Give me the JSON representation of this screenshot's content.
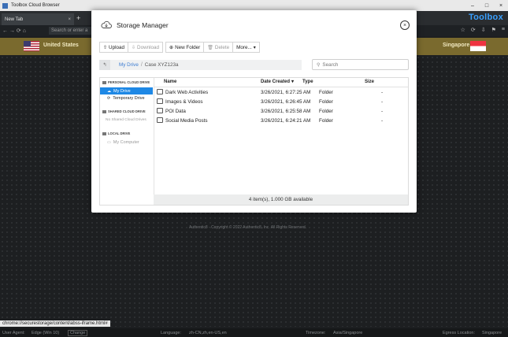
{
  "browser": {
    "window_title": "Toolbox Cloud Browser",
    "tab_title": "New Tab",
    "tab_close": "×",
    "new_tab": "+",
    "address_placeholder": "Search or enter a",
    "brand": "Toolbox",
    "window_controls": [
      "–",
      "□",
      "×"
    ],
    "nav": "← → ⟳ ⌂",
    "tools": [
      "☆",
      "⟳",
      "⇩",
      "⚑",
      "≡"
    ]
  },
  "banner": {
    "from_country": "United States",
    "to_country": "Singapore"
  },
  "page": {
    "footnote": "Authentic8 · Copyright © 2022 Authentic8, Inc. All Rights Reserved."
  },
  "status_url": "chrome://securestorage/content/abss-iframe.html#",
  "bottom_bar": {
    "user_agent_label": "User Agent:",
    "user_agent_value": "Edge (Win 10)",
    "user_agent_change": "Change",
    "language_label": "Language:",
    "language_value": "zh-CN,zh,en-US,en",
    "timezone_label": "Timezone:",
    "timezone_value": "Asia/Singapore",
    "egress_label": "Egress Location:",
    "egress_value": "Singapore"
  },
  "modal": {
    "title": "Storage Manager",
    "toolbar": {
      "upload": "Upload",
      "download": "Download",
      "new_folder": "New Folder",
      "delete": "Delete",
      "more": "More..."
    },
    "breadcrumb": [
      "My Drive",
      "Case XYZ123a"
    ],
    "search_placeholder": "Search",
    "sidebar": {
      "personal_header": "PERSONAL CLOUD DRIVE",
      "my_drive": "My Drive",
      "temporary_drive": "Temporary Drive",
      "shared_header": "SHARED CLOUD DRIVE",
      "shared_empty": "No Shared Cloud Drives",
      "local_header": "LOCAL DRIVE",
      "my_computer": "My Computer"
    },
    "columns": {
      "name": "Name",
      "date": "Date Created",
      "type": "Type",
      "size": "Size"
    },
    "rows": [
      {
        "name": "Dark Web Activities",
        "date": "3/26/2021, 6:27:25 AM",
        "type": "Folder",
        "size": "-"
      },
      {
        "name": "Images & Videos",
        "date": "3/26/2021, 6:26:45 AM",
        "type": "Folder",
        "size": "-"
      },
      {
        "name": "POI Data",
        "date": "3/26/2021, 6:25:58 AM",
        "type": "Folder",
        "size": "-"
      },
      {
        "name": "Social Media Posts",
        "date": "3/26/2021, 6:24:21 AM",
        "type": "Folder",
        "size": "-"
      }
    ],
    "footer": "4 item(s), 1.000 GB available"
  }
}
